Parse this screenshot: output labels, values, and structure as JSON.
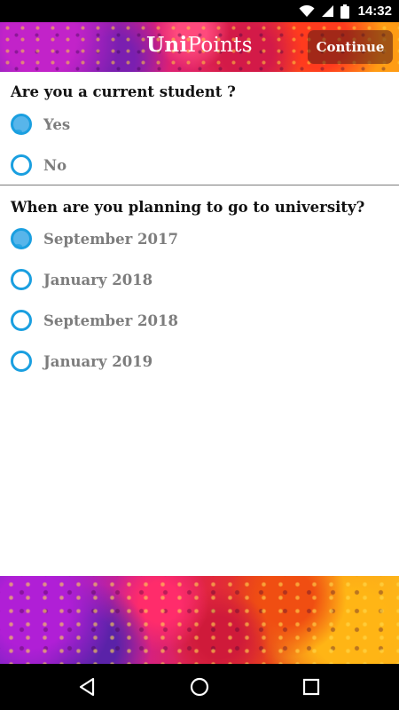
{
  "status_bar": {
    "time": "14:32",
    "icons": [
      "wifi-icon",
      "signal-icon",
      "battery-icon"
    ]
  },
  "app_bar": {
    "brand_bold": "Uni",
    "brand_light": "Points",
    "continue_label": "Continue"
  },
  "questions": [
    {
      "text": "Are you a current student ?",
      "options": [
        {
          "label": "Yes",
          "selected": true
        },
        {
          "label": "No",
          "selected": false
        }
      ]
    },
    {
      "text": "When are you planning to go to  university?",
      "options": [
        {
          "label": "September 2017",
          "selected": true
        },
        {
          "label": "January 2018",
          "selected": false
        },
        {
          "label": "September 2018",
          "selected": false
        },
        {
          "label": "January 2019",
          "selected": false
        }
      ]
    }
  ],
  "colors": {
    "accent": "#1a9fe0",
    "radio_fill": "#58b5ea",
    "option_text": "#7d7d7d"
  },
  "nav_bar": {
    "icons": [
      "back-icon",
      "home-icon",
      "recents-icon"
    ]
  }
}
